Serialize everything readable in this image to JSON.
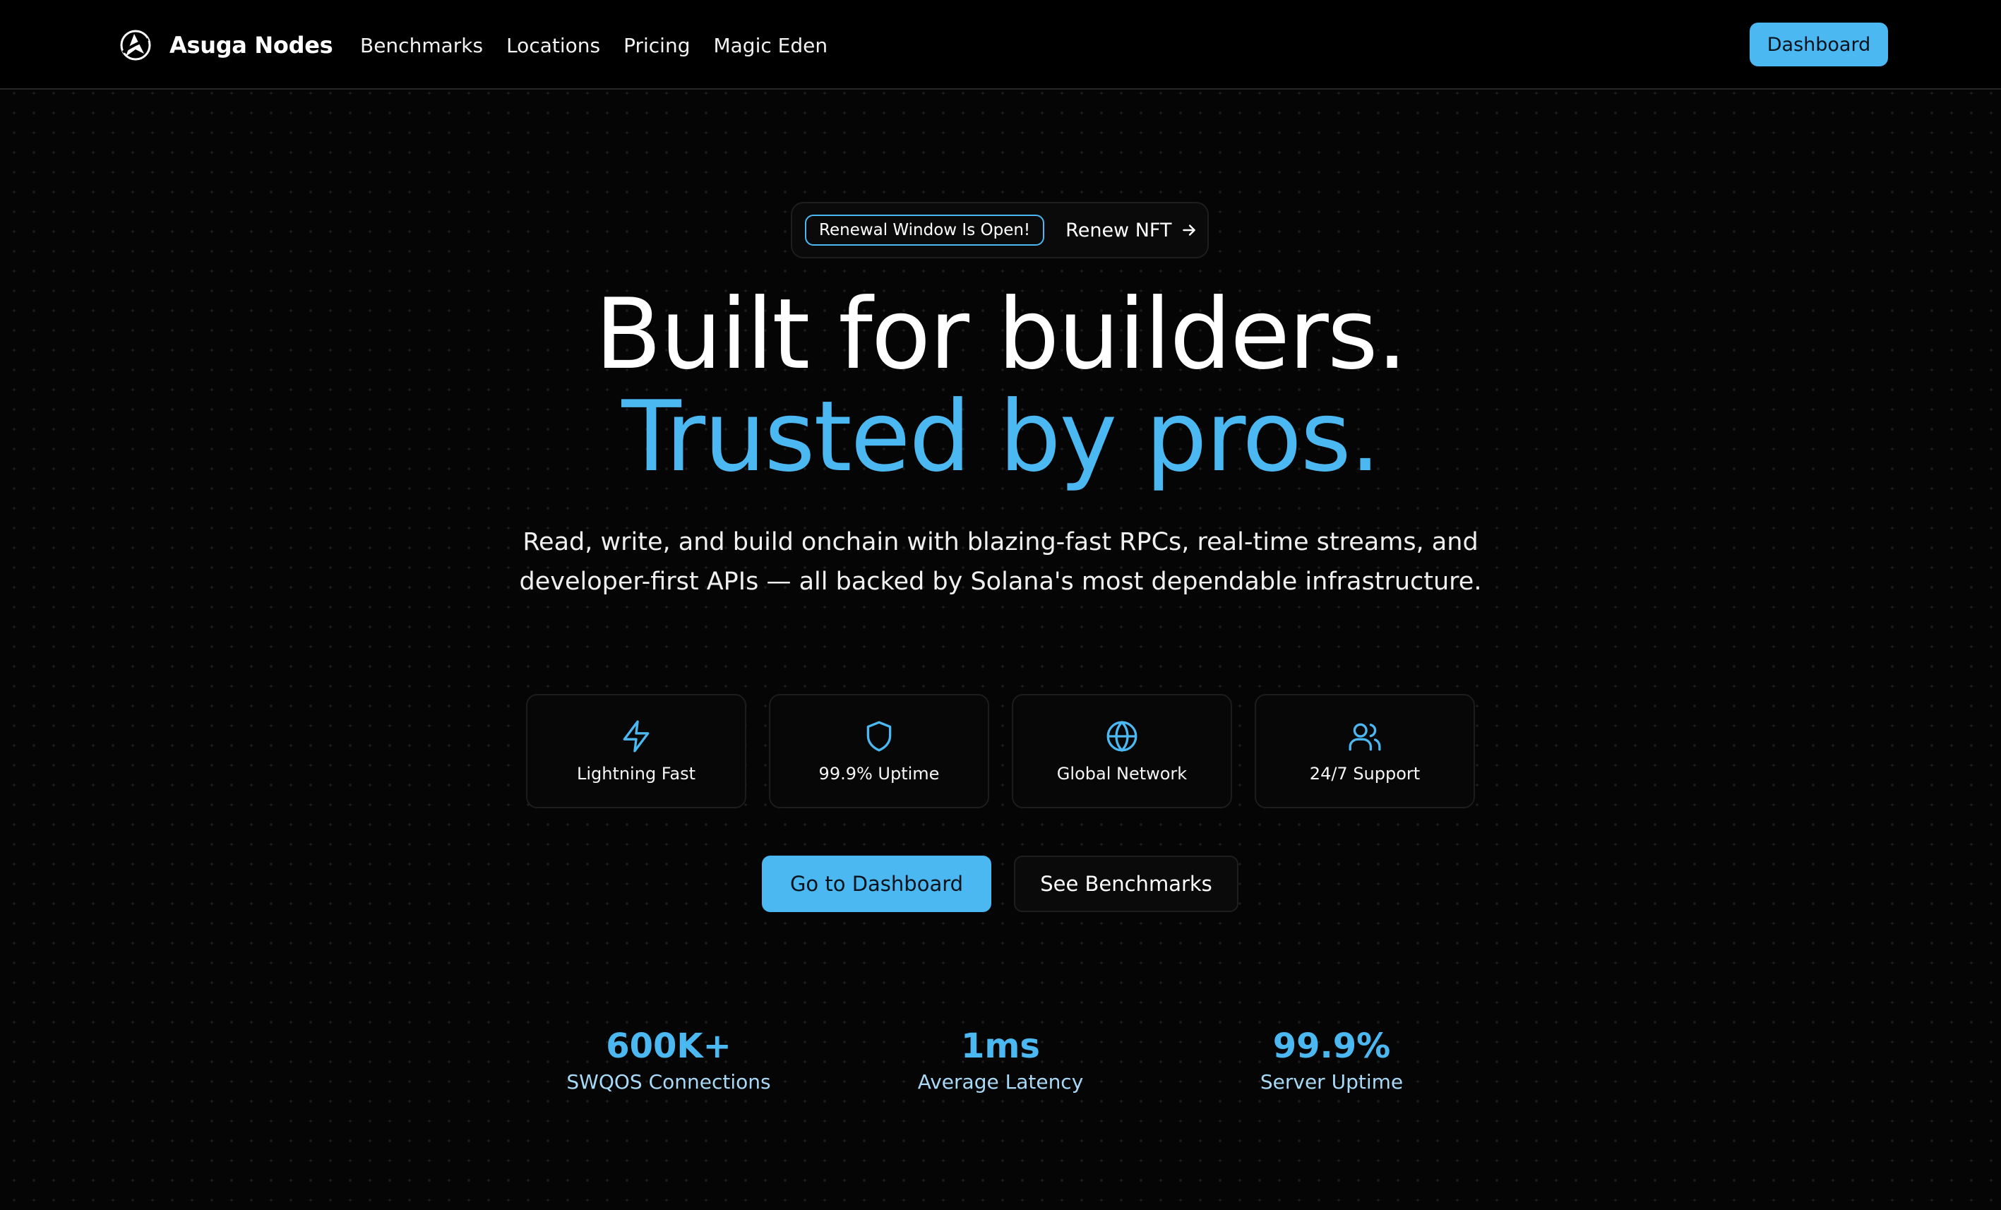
{
  "nav": {
    "brand": "Asuga Nodes",
    "logo_icon": "asuga-logo",
    "links": [
      "Benchmarks",
      "Locations",
      "Pricing",
      "Magic Eden"
    ],
    "dashboard_label": "Dashboard"
  },
  "announcement": {
    "badge": "Renewal Window Is Open!",
    "link_label": "Renew NFT",
    "link_icon": "arrow-right-icon"
  },
  "hero": {
    "headline_1": "Built for builders.",
    "headline_2": "Trusted by pros.",
    "subtitle": "Read, write, and build onchain with blazing-fast RPCs, real-time streams, and developer-first APIs — all backed by Solana's most dependable infrastructure."
  },
  "features": [
    {
      "icon": "lightning-icon",
      "label": "Lightning Fast"
    },
    {
      "icon": "shield-icon",
      "label": "99.9% Uptime"
    },
    {
      "icon": "globe-icon",
      "label": "Global Network"
    },
    {
      "icon": "users-icon",
      "label": "24/7 Support"
    }
  ],
  "cta": {
    "primary_label": "Go to Dashboard",
    "secondary_label": "See Benchmarks"
  },
  "stats": [
    {
      "value": "600K+",
      "label": "SWQOS Connections"
    },
    {
      "value": "1ms",
      "label": "Average Latency"
    },
    {
      "value": "99.9%",
      "label": "Server Uptime"
    }
  ],
  "colors": {
    "accent": "#4cb8f2",
    "background": "#050505",
    "card_border": "#1c1c1c",
    "stat_label": "#a8d9f6"
  }
}
